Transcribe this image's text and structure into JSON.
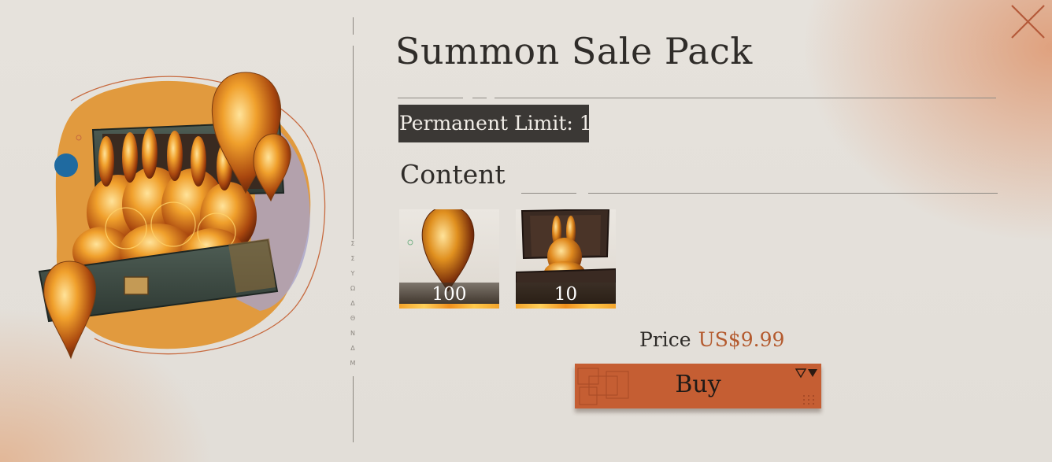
{
  "title": "Summon Sale Pack",
  "limit_badge": "Permanent Limit: 1",
  "content_heading": "Content",
  "items": [
    {
      "icon": "amber-crystal-icon",
      "quantity": "100"
    },
    {
      "icon": "rabbit-statue-box-icon",
      "quantity": "10"
    }
  ],
  "price": {
    "label": "Price",
    "value": "US$9.99"
  },
  "buy_label": "Buy",
  "vertical_text": "ΣΣΥΩΔΘΝΔΜ",
  "colors": {
    "accent": "#c55e33",
    "price": "#b45a2e",
    "badge_bg": "#3b3835",
    "text": "#2f2c29"
  }
}
